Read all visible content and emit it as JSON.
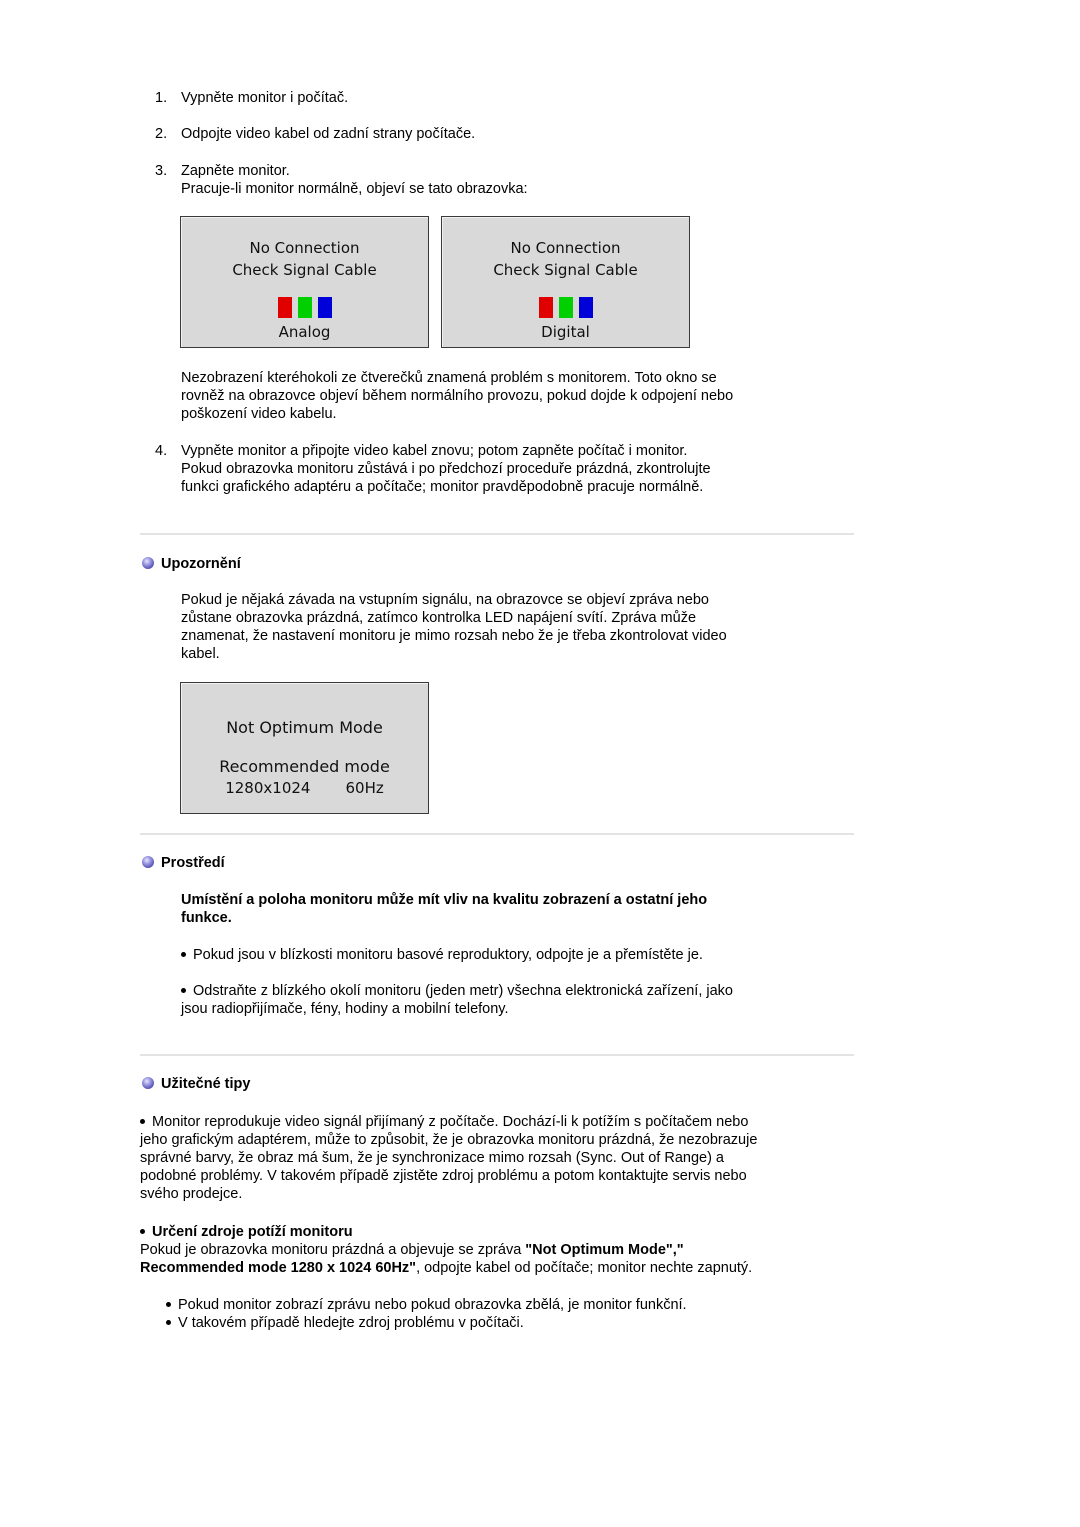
{
  "steps": [
    {
      "number": "1.",
      "text": "Vypněte monitor i počítač."
    },
    {
      "number": "2.",
      "text": "Odpojte video kabel od zadní strany počítače."
    },
    {
      "number": "3.",
      "text": "Zapněte monitor.",
      "subtext": "Pracuje-li monitor normálně, objeví se tato obrazovka:"
    }
  ],
  "osd_no_connection": [
    {
      "line1": "No Connection",
      "line2": "Check Signal Cable",
      "label": "Analog"
    },
    {
      "line1": "No Connection",
      "line2": "Check Signal Cable",
      "label": "Digital"
    }
  ],
  "osd_colors": {
    "red": "#e00000",
    "green": "#00d000",
    "blue": "#0000d8"
  },
  "no_connection_note": {
    "lines": [
      "Nezobrazení kteréhokoli ze čtverečků znamená problém s monitorem. Toto okno se",
      "rovněž na obrazovce objeví během normálního provozu, pokud dojde k odpojení nebo",
      "poškození video kabelu."
    ]
  },
  "step4": {
    "number": "4.",
    "lines": [
      "Vypněte monitor a připojte video kabel znovu; potom zapněte počítač i monitor.",
      "Pokud obrazovka monitoru zůstává i po předchozí proceduře prázdná, zkontrolujte",
      "funkci grafického adaptéru a počítače; monitor pravděpodobně pracuje normálně."
    ]
  },
  "warning_section": {
    "title": "Upozornění",
    "lines": [
      "Pokud je nějaká závada na vstupním signálu, na obrazovce se objeví zpráva nebo",
      "zůstane obrazovka prázdná, zatímco kontrolka LED napájení svítí. Zpráva může",
      "znamenat, že nastavení monitoru je mimo rozsah nebo že je třeba zkontrolovat video",
      "kabel."
    ],
    "osd": {
      "line1": "Not Optimum Mode",
      "line2": "Recommended mode",
      "line3": "1280x1024    60Hz"
    }
  },
  "environment_section": {
    "title": "Prostředí",
    "bold_lines": [
      "Umístění a poloha monitoru může mít vliv na kvalitu zobrazení a ostatní jeho",
      "funkce."
    ],
    "bullets": [
      {
        "lines": [
          "Pokud jsou v blízkosti monitoru basové reproduktory, odpojte je a přemístěte je."
        ]
      },
      {
        "lines": [
          "Odstraňte z blízkého okolí monitoru (jeden metr) všechna elektronická zařízení, jako",
          "jsou radiopřijímače, fény, hodiny a mobilní telefony."
        ]
      }
    ]
  },
  "tips_section": {
    "title": "Užitečné tipy",
    "bullet_lines": [
      "Monitor reprodukuje video signál přijímaný z počítače. Dochází-li k potížím s počítačem nebo",
      "jeho grafickým adaptérem, může to způsobit, že je obrazovka monitoru prázdná, že nezobrazuje",
      "správné barvy, že obraz má šum, že je synchronizace mimo rozsah (Sync. Out of Range) a",
      "podobné problémy. V takovém případě zjistěte zdroj problému a potom kontaktujte servis nebo",
      "svého prodejce."
    ],
    "diagnosis_title": "Určení zdroje potíží monitoru",
    "diagnosis_line1_pre": "Pokud je obrazovka monitoru prázdná a objevuje se zpráva ",
    "diagnosis_line1_bold": "\"Not Optimum Mode\",\"",
    "diagnosis_line2_bold": "Recommended mode 1280 x 1024 60Hz\"",
    "diagnosis_line2_post": ", odpojte kabel od počítače; monitor nechte zapnutý.",
    "sub_bullets": [
      "Pokud monitor zobrazí zprávu nebo pokud obrazovka zbělá, je monitor funkční.",
      "V takovém případě hledejte zdroj problému v počítači."
    ]
  }
}
